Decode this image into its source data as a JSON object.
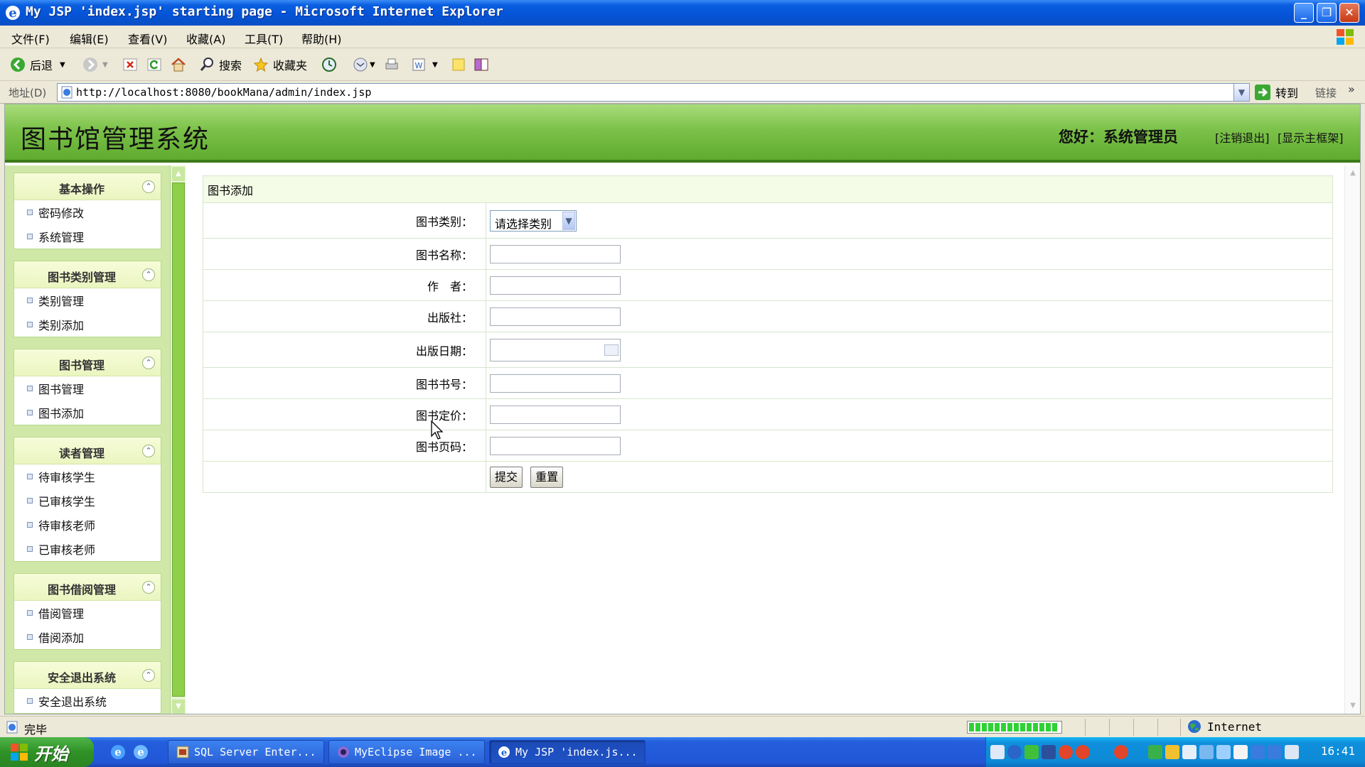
{
  "window": {
    "title": "My JSP 'index.jsp' starting page - Microsoft Internet Explorer"
  },
  "menu": [
    "文件(F)",
    "编辑(E)",
    "查看(V)",
    "收藏(A)",
    "工具(T)",
    "帮助(H)"
  ],
  "toolbar": {
    "back_label": "后退",
    "search_label": "搜索",
    "favorites_label": "收藏夹"
  },
  "address": {
    "label": "地址(D)",
    "url": "http://localhost:8080/bookMana/admin/index.jsp",
    "go_label": "转到",
    "links_label": "链接"
  },
  "header": {
    "system_title": "图书馆管理系统",
    "greeting": "您好：系统管理员",
    "logout_link": "[注销退出]",
    "show_frame_link": "[显示主框架]"
  },
  "sidebar": {
    "panels": [
      {
        "title": "基本操作",
        "items": [
          "密码修改",
          "系统管理"
        ]
      },
      {
        "title": "图书类别管理",
        "items": [
          "类别管理",
          "类别添加"
        ]
      },
      {
        "title": "图书管理",
        "items": [
          "图书管理",
          "图书添加"
        ]
      },
      {
        "title": "读者管理",
        "items": [
          "待审核学生",
          "已审核学生",
          "待审核老师",
          "已审核老师"
        ]
      },
      {
        "title": "图书借阅管理",
        "items": [
          "借阅管理",
          "借阅添加"
        ]
      },
      {
        "title": "安全退出系统",
        "items": [
          "安全退出系统"
        ]
      }
    ]
  },
  "form": {
    "caption": "图书添加",
    "category_label": "图书类别：",
    "category_value": "请选择类别",
    "name_label": "图书名称：",
    "author_label": "作　者：",
    "publisher_label": "出版社：",
    "pubdate_label": "出版日期：",
    "isbn_label": "图书书号：",
    "price_label": "图书定价：",
    "pages_label": "图书页码：",
    "submit_label": "提交",
    "reset_label": "重置"
  },
  "statusbar": {
    "status_text": "完毕",
    "zone": "Internet"
  },
  "taskbar": {
    "start_label": "开始",
    "tasks": [
      "SQL Server Enter...",
      "MyEclipse Image ...",
      "My JSP 'index.js..."
    ],
    "clock": "16:41"
  },
  "colors": {
    "header_green": "#7cc24a",
    "sidebar_green": "#cfe8a8",
    "xp_blue": "#0553d6"
  }
}
